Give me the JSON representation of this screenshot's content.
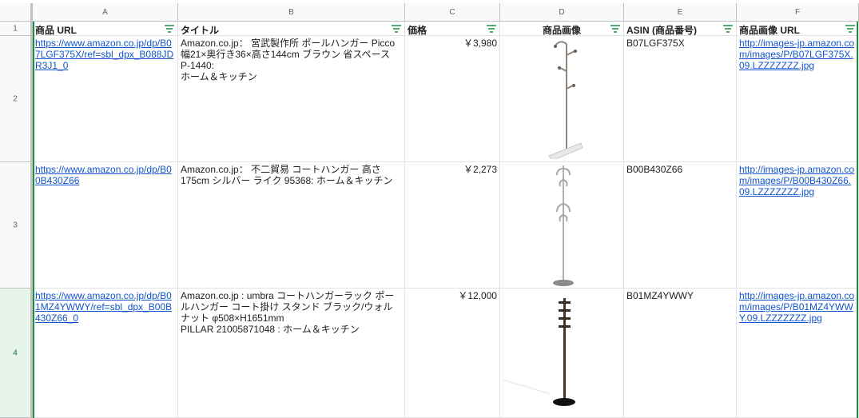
{
  "columns": [
    "A",
    "B",
    "C",
    "D",
    "E",
    "F"
  ],
  "row_numbers": [
    "1",
    "2",
    "3",
    "4"
  ],
  "headers": {
    "url": "商品 URL",
    "title": "タイトル",
    "price": "価格",
    "image": "商品画像",
    "asin": "ASIN (商品番号)",
    "image_url": "商品画像 URL"
  },
  "rows": [
    {
      "url": "https://www.amazon.co.jp/dp/B07LGF375X/ref=sbl_dpx_B088JDR3J1_0",
      "title_line1": "Amazon.co.jp： 宮武製作所 ポールハンガー Picco 幅21×奥行き36×高さ144cm ブラウン 省スペース P-1440:",
      "title_line2": "ホーム＆キッチン",
      "price": "￥3,980",
      "asin": "B07LGF375X",
      "image_url": "http://images-jp.amazon.com/images/P/B07LGF375X.09.LZZZZZZZ.jpg"
    },
    {
      "url": "https://www.amazon.co.jp/dp/B00B430Z66",
      "title_line1": "Amazon.co.jp： 不二貿易 コートハンガー 高さ175cm シルバー ライク 95368: ホーム＆キッチン",
      "title_line2": "",
      "price": "￥2,273",
      "asin": "B00B430Z66",
      "image_url": "http://images-jp.amazon.com/images/P/B00B430Z66.09.LZZZZZZZ.jpg"
    },
    {
      "url": "https://www.amazon.co.jp/dp/B01MZ4YWWY/ref=sbl_dpx_B00B430Z66_0",
      "title_line1": "Amazon.co.jp : umbra コートハンガーラック ポールハンガー コート掛け スタンド ブラック/ウォルナット φ508×H1651mm",
      "title_line2": "PILLAR 21005871048 : ホーム＆キッチン",
      "price": "￥12,000",
      "asin": "B01MZ4YWWY",
      "image_url": "http://images-jp.amazon.com/images/P/B01MZ4YWWY.09.LZZZZZZZ.jpg"
    }
  ],
  "colors": {
    "header_bg": "#f8f9fa",
    "selected": "#e6f4ea",
    "accent": "#1e8e3e",
    "link": "#1155cc"
  },
  "icons": {
    "filter": "filter-icon"
  }
}
